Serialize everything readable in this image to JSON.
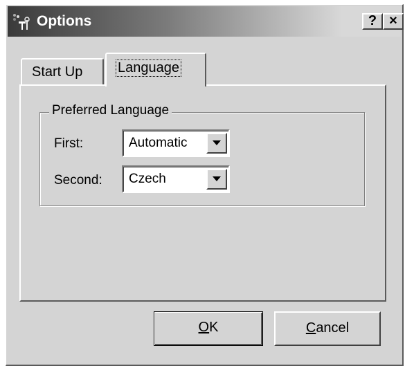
{
  "window": {
    "title": "Options",
    "help_label": "?",
    "close_label": "×",
    "icon": "options-tools-icon"
  },
  "tabs": [
    {
      "label": "Start Up",
      "selected": false
    },
    {
      "label": "Language",
      "selected": true
    }
  ],
  "preferred_language": {
    "group_title": "Preferred Language",
    "first": {
      "label": "First:",
      "value": "Automatic"
    },
    "second": {
      "label": "Second:",
      "value": "Czech"
    }
  },
  "buttons": {
    "ok": {
      "mnemonic": "O",
      "rest": "K"
    },
    "cancel": {
      "mnemonic": "C",
      "rest": "ancel"
    }
  },
  "colors": {
    "face": "#d4d4d4",
    "titlebar_start": "#3a3a3a",
    "titlebar_end": "#d8d8d8"
  }
}
